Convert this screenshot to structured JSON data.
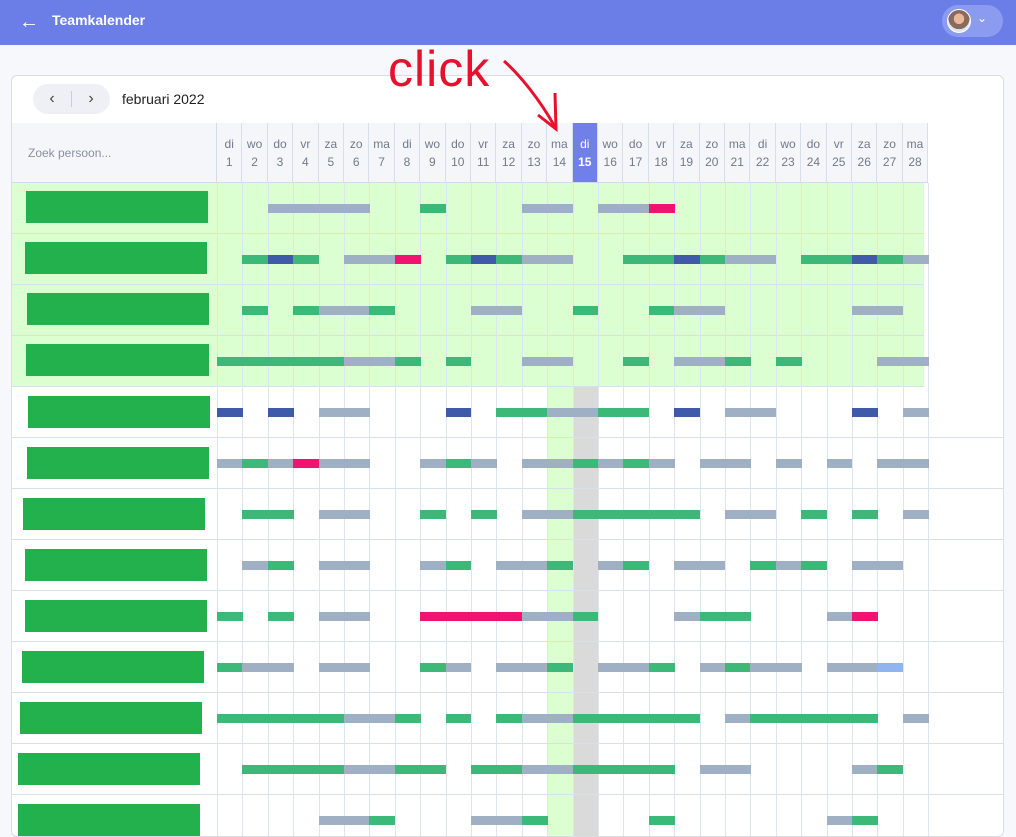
{
  "header": {
    "title": "Teamkalender",
    "back_icon": "arrow-left-icon",
    "user_chevron": "⌄"
  },
  "toolbar": {
    "prev_label": "‹",
    "next_label": "›",
    "month": "februari 2022"
  },
  "search": {
    "placeholder": "Zoek persoon..."
  },
  "days": [
    {
      "wd": "di",
      "d": "1"
    },
    {
      "wd": "wo",
      "d": "2"
    },
    {
      "wd": "do",
      "d": "3"
    },
    {
      "wd": "vr",
      "d": "4"
    },
    {
      "wd": "za",
      "d": "5"
    },
    {
      "wd": "zo",
      "d": "6"
    },
    {
      "wd": "ma",
      "d": "7"
    },
    {
      "wd": "di",
      "d": "8"
    },
    {
      "wd": "wo",
      "d": "9"
    },
    {
      "wd": "do",
      "d": "10"
    },
    {
      "wd": "vr",
      "d": "11"
    },
    {
      "wd": "za",
      "d": "12"
    },
    {
      "wd": "zo",
      "d": "13"
    },
    {
      "wd": "ma",
      "d": "14"
    },
    {
      "wd": "di",
      "d": "15",
      "today": true
    },
    {
      "wd": "wo",
      "d": "16"
    },
    {
      "wd": "do",
      "d": "17"
    },
    {
      "wd": "vr",
      "d": "18"
    },
    {
      "wd": "za",
      "d": "19"
    },
    {
      "wd": "zo",
      "d": "20"
    },
    {
      "wd": "ma",
      "d": "21"
    },
    {
      "wd": "di",
      "d": "22"
    },
    {
      "wd": "wo",
      "d": "23"
    },
    {
      "wd": "do",
      "d": "24"
    },
    {
      "wd": "vr",
      "d": "25"
    },
    {
      "wd": "za",
      "d": "26"
    },
    {
      "wd": "zo",
      "d": "27"
    },
    {
      "wd": "ma",
      "d": "28"
    }
  ],
  "colors": {
    "green": "#3cb878",
    "grey": "#9fb0c4",
    "blue": "#3e5aa8",
    "pink": "#f0136f",
    "lightblue": "#90b4ef",
    "violet": "#7a88d0"
  },
  "rows": [
    {
      "highlight": true,
      "segs": "  ....  g   .. ..p"
    },
    {
      "highlight": true,
      "segs": " gbgi..p gbg..  ggbg.. ggbg.."
    },
    {
      "highlight": true,
      "segs": " g g..g   ..  g  g..     .."
    },
    {
      "highlight": true,
      "segs": "ggggg..g g  ..  g ..g g   .."
    },
    {
      "highlight": false,
      "segs": "b b ..   b gg..gg b ..   b ..v"
    },
    {
      "highlight": false,
      "segs": ".g.p..  .g. ..g.g. .. . . .."
    },
    {
      "highlight": false,
      "segs": " gg ..  g g ..ggggg .. g g .."
    },
    {
      "highlight": false,
      "segs": " .g ..  .g ..g .g .. g.g .."
    },
    {
      "highlight": false,
      "segs": "g g ..  pppp..g   .gg   .p"
    },
    {
      "highlight": false,
      "segs": "g.. ..  g. ..g ..g .g.. ..l"
    },
    {
      "highlight": false,
      "segs": "ggggg..g g g..ggggg .ggggg .g"
    },
    {
      "highlight": false,
      "segs": " gggg..gg gg..gggg ..    .g"
    },
    {
      "highlight": false,
      "segs": "    ..g   ..g    g      .g"
    }
  ],
  "annotation": {
    "text": "click"
  }
}
